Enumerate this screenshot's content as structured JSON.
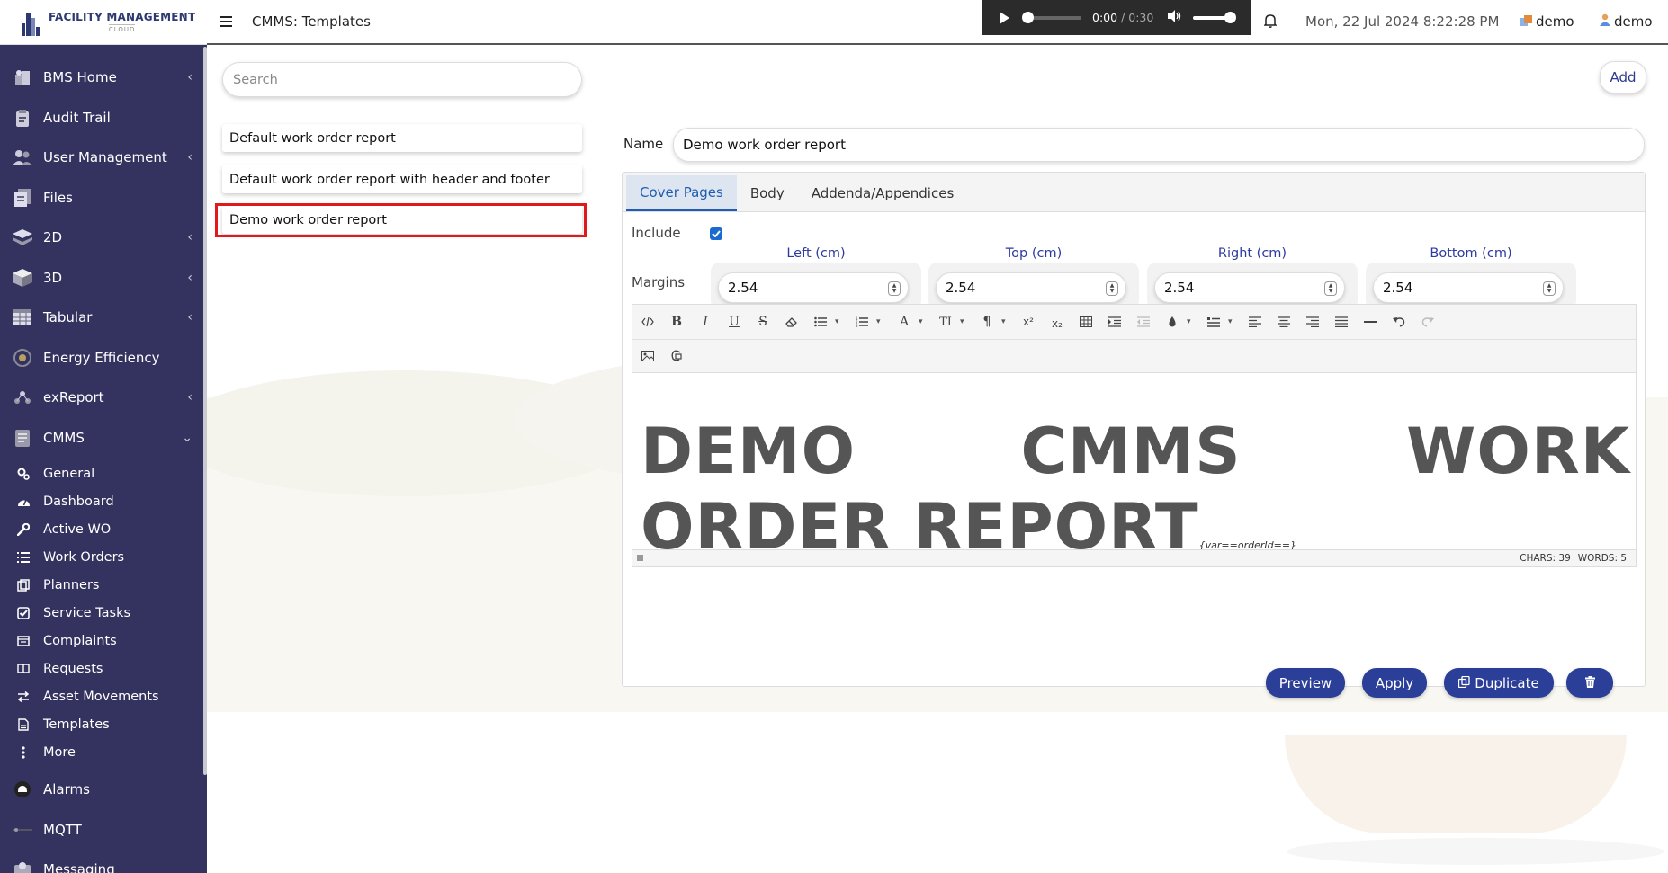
{
  "app": {
    "logo_title": "FACILITY MANAGEMENT",
    "logo_subtitle": "CLOUD",
    "page_title": "CMMS: Templates"
  },
  "player": {
    "current": "0:00",
    "separator": " / ",
    "duration": "0:30",
    "progress": 0,
    "volume": 1.0
  },
  "header": {
    "datetime": "Mon, 22 Jul 2024 8:22:28 PM",
    "org": "demo",
    "user": "demo"
  },
  "sidebar": {
    "items": [
      {
        "label": "BMS Home",
        "icon": "building-icon",
        "chevron": "‹"
      },
      {
        "label": "Audit Trail",
        "icon": "clipboard-icon",
        "chevron": ""
      },
      {
        "label": "User Management",
        "icon": "users-icon",
        "chevron": "‹"
      },
      {
        "label": "Files",
        "icon": "files-icon",
        "chevron": ""
      },
      {
        "label": "2D",
        "icon": "layers-2d-icon",
        "chevron": "‹"
      },
      {
        "label": "3D",
        "icon": "cube-3d-icon",
        "chevron": "‹"
      },
      {
        "label": "Tabular",
        "icon": "table-icon",
        "chevron": "‹"
      },
      {
        "label": "Energy Efficiency",
        "icon": "energy-icon",
        "chevron": ""
      },
      {
        "label": "exReport",
        "icon": "report-icon",
        "chevron": "‹"
      },
      {
        "label": "CMMS",
        "icon": "cmms-icon",
        "chevron": "⌄"
      }
    ],
    "cmms_sub": [
      {
        "label": "General",
        "icon": "cogs-icon"
      },
      {
        "label": "Dashboard",
        "icon": "dashboard-icon"
      },
      {
        "label": "Active WO",
        "icon": "wrench-icon"
      },
      {
        "label": "Work Orders",
        "icon": "list-icon"
      },
      {
        "label": "Planners",
        "icon": "planner-icon"
      },
      {
        "label": "Service Tasks",
        "icon": "check-square-icon"
      },
      {
        "label": "Complaints",
        "icon": "complaint-icon"
      },
      {
        "label": "Requests",
        "icon": "book-icon"
      },
      {
        "label": "Asset Movements",
        "icon": "exchange-icon"
      },
      {
        "label": "Templates",
        "icon": "template-icon"
      },
      {
        "label": "More",
        "icon": "more-vertical-icon"
      }
    ],
    "bottom_items": [
      {
        "label": "Alarms",
        "icon": "alarm-icon"
      },
      {
        "label": "MQTT",
        "icon": "mqtt-icon"
      },
      {
        "label": "Messaging",
        "icon": "messaging-icon"
      }
    ]
  },
  "templates": {
    "search_placeholder": "Search",
    "add_label": "Add",
    "items": [
      "Default work order report",
      "Default work order report with header and footer",
      "Demo work order report"
    ],
    "selected_index": 2
  },
  "editor": {
    "name_label": "Name",
    "name_value": "Demo work order report",
    "tabs": [
      "Cover Pages",
      "Body",
      "Addenda/Appendices"
    ],
    "active_tab": "Cover Pages",
    "include_label": "Include",
    "include_checked": true,
    "margins_label": "Margins",
    "margins": [
      {
        "label": "Left (cm)",
        "value": "2.54"
      },
      {
        "label": "Top (cm)",
        "value": "2.54"
      },
      {
        "label": "Right (cm)",
        "value": "2.54"
      },
      {
        "label": "Bottom (cm)",
        "value": "2.54"
      }
    ],
    "content_line1_words": [
      "DEMO",
      "CMMS",
      "WORK"
    ],
    "content_line2": "ORDER REPORT",
    "content_var": "{var==orderId==}",
    "chars": "CHARS: 39",
    "words": "WORDS: 5"
  },
  "actions": {
    "preview": "Preview",
    "apply": "Apply",
    "duplicate": "Duplicate"
  },
  "colors": {
    "sidebar_bg": "#34325e",
    "accent": "#2b3f98",
    "highlight": "#e0191d",
    "tab_active": "#1e5db0"
  }
}
